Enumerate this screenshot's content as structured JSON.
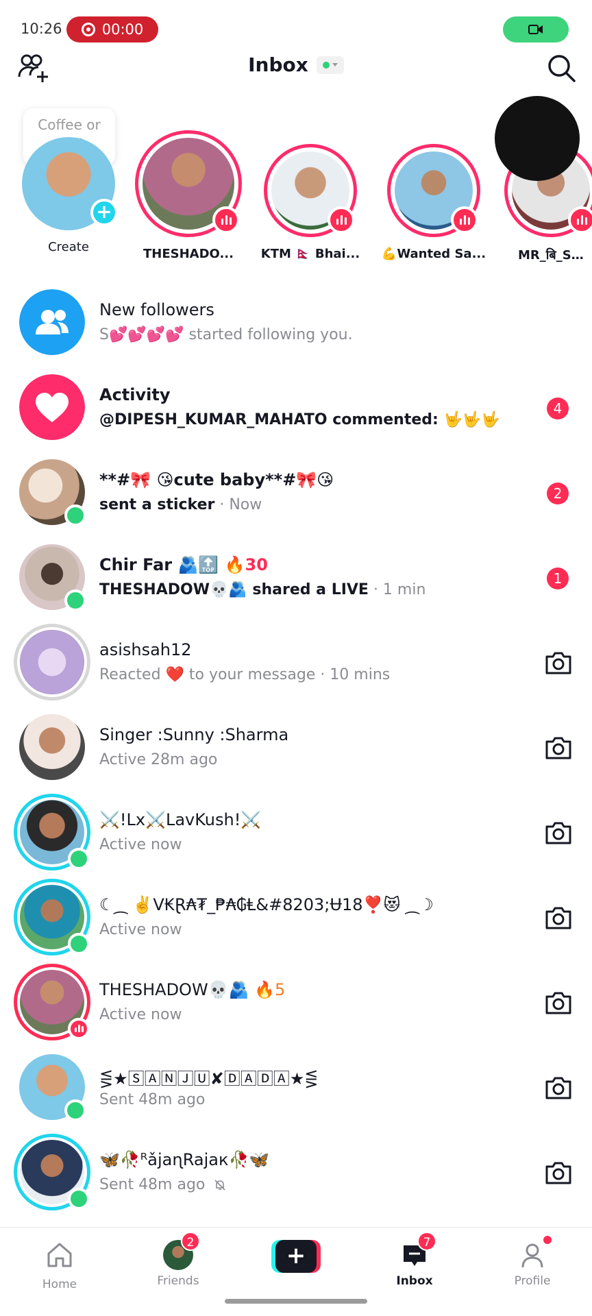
{
  "status_bar": {
    "time": "10:26",
    "recording": "00:00"
  },
  "header": {
    "title": "Inbox"
  },
  "stories": {
    "bubble": "Coffee or tea?",
    "items": [
      {
        "name": "Create",
        "live": false
      },
      {
        "name": "THESHADO...",
        "live": true
      },
      {
        "name": "KTM 🇳🇵 Bhai...",
        "live": true
      },
      {
        "name": "💪Wanted Sa...",
        "live": true
      },
      {
        "name": "MR_बि_SHA...",
        "live": true
      }
    ]
  },
  "list": [
    {
      "title": "New followers",
      "subtitle": "S💕💕💕💕 started following you.",
      "type": "system"
    },
    {
      "title": "Activity",
      "subtitle": "@DIPESH_KUMAR_MAHATO commented: 🤟🤟🤟",
      "badge": "4",
      "type": "system"
    },
    {
      "title": "**#🎀 😘cute baby**#🎀😘",
      "sub_bold": "sent a sticker",
      "sub_meta": " · Now",
      "badge": "2"
    },
    {
      "title": "Chir Far 🫂🔝",
      "streak": "🔥30",
      "sub_bold": "THESHADOW💀🫂 shared a LIVE",
      "sub_meta": " · 1 min",
      "badge": "1"
    },
    {
      "title": "asishsah12",
      "subtitle": "Reacted ❤️ to your message · 10 mins"
    },
    {
      "title": "Singer :Sunny :Sharma",
      "subtitle": "Active 28m ago"
    },
    {
      "title": "⚔️!Lx⚔️LavKush!⚔️",
      "subtitle": "Active now"
    },
    {
      "title": "☾⁔ ✌️V₭Ɽ₳₮_₱₳₲Ⱡ&#8203;Ʉ18❣️😻 ⁔☽",
      "subtitle": "Active now"
    },
    {
      "title": "THESHADOW💀🫂",
      "streak": "🔥5",
      "subtitle": "Active now"
    },
    {
      "title": "⋚★🅂🄰🄽🄹🅄✘🄳🄰🄳🄰★⋚",
      "subtitle": "Sent 48m ago"
    },
    {
      "title": "🦋🥀ᴿǎjaɳRajaк🥀🦋",
      "subtitle": "Sent 48m ago"
    }
  ],
  "nav": {
    "home": "Home",
    "friends": "Friends",
    "friends_badge": "2",
    "inbox": "Inbox",
    "inbox_badge": "7",
    "profile": "Profile"
  },
  "colors": {
    "accent": "#fe2c55",
    "teal": "#20d5ec",
    "online": "#2dd27a"
  }
}
